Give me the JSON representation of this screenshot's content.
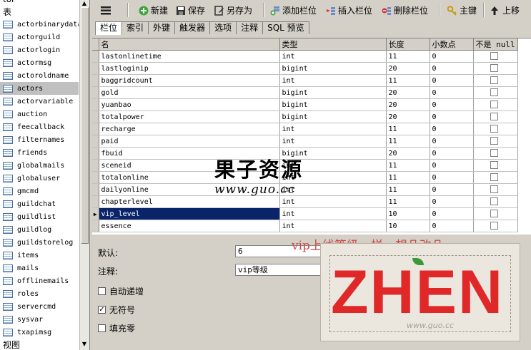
{
  "left_panel": {
    "top_caption": "tor",
    "header": "表",
    "tables": [
      "actorbinarydata",
      "actorguild",
      "actorlogin",
      "actormsg",
      "actoroldname",
      "actors",
      "actorvariable",
      "auction",
      "feecallback",
      "filternames",
      "friends",
      "globalmails",
      "globaluser",
      "gmcmd",
      "guildchat",
      "guildlist",
      "guildlog",
      "guildstorelog",
      "items",
      "mails",
      "offlinemails",
      "roles",
      "servercmd",
      "sysvar",
      "txapimsg"
    ],
    "selected_index": 5,
    "footer": "视图"
  },
  "toolbar": {
    "new": "新建",
    "save": "保存",
    "save_as": "另存为",
    "add_field": "添加栏位",
    "insert_field": "插入栏位",
    "delete_field": "删除栏位",
    "primary_key": "主键",
    "move_up": "上移"
  },
  "tabs": [
    "栏位",
    "索引",
    "外键",
    "触发器",
    "选项",
    "注释",
    "SQL 预览"
  ],
  "grid": {
    "columns": [
      "名",
      "类型",
      "长度",
      "小数点",
      "不是 null"
    ],
    "rows": [
      {
        "name": "lastonlinetime",
        "type": "int",
        "length": "11",
        "decimals": "0"
      },
      {
        "name": "lastloginip",
        "type": "bigint",
        "length": "20",
        "decimals": "0"
      },
      {
        "name": "baggridcount",
        "type": "int",
        "length": "11",
        "decimals": "0"
      },
      {
        "name": "gold",
        "type": "bigint",
        "length": "20",
        "decimals": "0"
      },
      {
        "name": "yuanbao",
        "type": "bigint",
        "length": "20",
        "decimals": "0"
      },
      {
        "name": "totalpower",
        "type": "bigint",
        "length": "20",
        "decimals": "0"
      },
      {
        "name": "recharge",
        "type": "int",
        "length": "11",
        "decimals": "0"
      },
      {
        "name": "paid",
        "type": "int",
        "length": "11",
        "decimals": "0"
      },
      {
        "name": "fbuid",
        "type": "bigint",
        "length": "20",
        "decimals": "0"
      },
      {
        "name": "sceneid",
        "type": "int",
        "length": "11",
        "decimals": "0"
      },
      {
        "name": "totalonline",
        "type": "int",
        "length": "11",
        "decimals": "0"
      },
      {
        "name": "dailyonline",
        "type": "int",
        "length": "11",
        "decimals": "0"
      },
      {
        "name": "chapterlevel",
        "type": "int",
        "length": "11",
        "decimals": "0"
      },
      {
        "name": "vip_level",
        "type": "int",
        "length": "10",
        "decimals": "0"
      },
      {
        "name": "essence",
        "type": "int",
        "length": "10",
        "decimals": "0"
      }
    ],
    "selected_row": 13
  },
  "properties": {
    "default_label": "默认:",
    "default_value": "6",
    "comment_label": "注释:",
    "comment_value": "vip等级",
    "auto_increment": "自动递增",
    "unsigned": "无符号",
    "zerofill": "填充零"
  },
  "watermark": {
    "site_name": "果子资源",
    "site_url": "www.guo.cc",
    "note": "vip上线等级一样，想几改几",
    "logo_text": "ZHEN",
    "logo_url": "www.guo.cc"
  },
  "colors": {
    "selection": "#0a246a",
    "note_red": "#d04848",
    "logo_red": "#e02828"
  }
}
